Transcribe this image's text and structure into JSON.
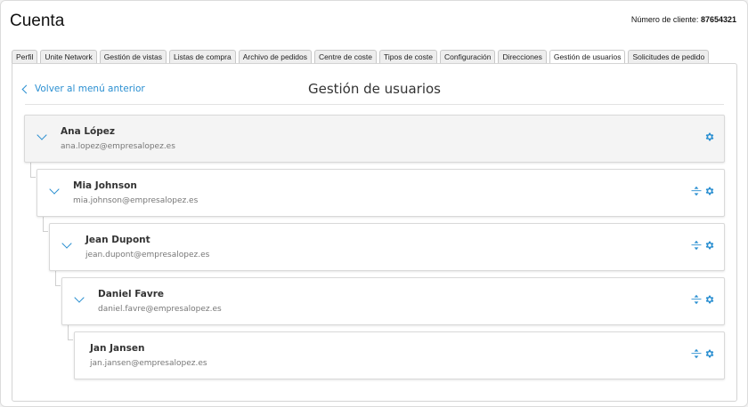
{
  "header": {
    "title": "Cuenta",
    "client_number_label": "Número de cliente:",
    "client_number_value": "87654321"
  },
  "tabs": [
    {
      "label": "Perfil"
    },
    {
      "label": "Unite Network"
    },
    {
      "label": "Gestión de vistas"
    },
    {
      "label": "Listas de compra"
    },
    {
      "label": "Archivo de pedidos"
    },
    {
      "label": "Centre de coste"
    },
    {
      "label": "Tipos de coste"
    },
    {
      "label": "Configuración"
    },
    {
      "label": "Direcciones"
    },
    {
      "label": "Gestión de usuarios",
      "active": true
    },
    {
      "label": "Solicitudes de pedido"
    }
  ],
  "main": {
    "back_label": "Volver al menú anterior",
    "section_title": "Gestión de usuarios"
  },
  "users": [
    {
      "name": "Ana López",
      "email": "ana.lopez@empresalopez.es",
      "expandable": true,
      "move_icon": false
    },
    {
      "name": "Mia Johnson",
      "email": "mia.johnson@empresalopez.es",
      "expandable": true,
      "move_icon": true
    },
    {
      "name": "Jean Dupont",
      "email": "jean.dupont@empresalopez.es",
      "expandable": true,
      "move_icon": true
    },
    {
      "name": "Daniel Favre",
      "email": "daniel.favre@empresalopez.es",
      "expandable": true,
      "move_icon": true
    },
    {
      "name": "Jan Jansen",
      "email": "jan.jansen@empresalopez.es",
      "expandable": false,
      "move_icon": true
    }
  ],
  "icons": {
    "expand": "chevron-down-icon",
    "move": "move-vertical-icon",
    "settings": "gear-icon"
  },
  "colors": {
    "accent": "#2a8fd1"
  }
}
